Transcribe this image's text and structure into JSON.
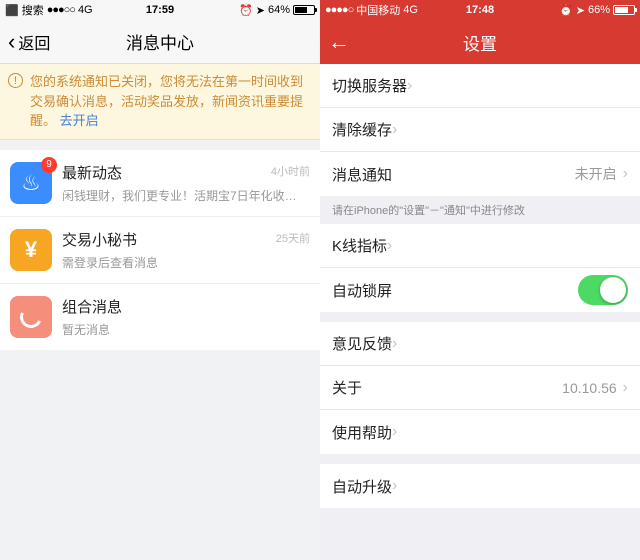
{
  "left": {
    "status": {
      "carrier": "搜索",
      "net": "4G",
      "time": "17:59",
      "battery": "64%"
    },
    "nav": {
      "back": "返回",
      "title": "消息中心"
    },
    "warn": {
      "text": "您的系统通知已关闭，您将无法在第一时间收到交易确认消息，活动奖品发放，新闻资讯重要提醒。",
      "link": "去开启"
    },
    "msgs": [
      {
        "title": "最新动态",
        "sub": "闲钱理财，我们更专业！活期宝7日年化收…",
        "date": "4小时前",
        "badge": "9"
      },
      {
        "title": "交易小秘书",
        "sub": "需登录后查看消息",
        "date": "25天前"
      },
      {
        "title": "组合消息",
        "sub": "暂无消息"
      }
    ]
  },
  "right": {
    "status": {
      "carrier": "中国移动",
      "net": "4G",
      "time": "17:48",
      "battery": "66%"
    },
    "nav": {
      "title": "设置"
    },
    "g1": [
      {
        "label": "切换服务器"
      },
      {
        "label": "清除缓存"
      },
      {
        "label": "消息通知",
        "val": "未开启"
      }
    ],
    "hint": "请在iPhone的\"设置\"－\"通知\"中进行修改",
    "g2": [
      {
        "label": "K线指标"
      },
      {
        "label": "自动锁屏",
        "toggle": true
      }
    ],
    "g3": [
      {
        "label": "意见反馈"
      },
      {
        "label": "关于",
        "val": "10.10.56"
      },
      {
        "label": "使用帮助"
      }
    ],
    "g4": [
      {
        "label": "自动升级"
      }
    ]
  }
}
